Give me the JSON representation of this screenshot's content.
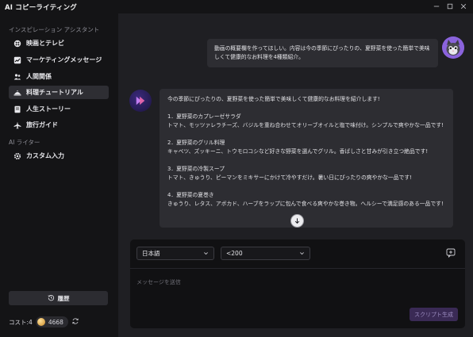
{
  "app": {
    "title": "AI コピーライティング"
  },
  "sidebar": {
    "section1_label": "インスピレーション アシスタント",
    "items": [
      {
        "label": "映画とテレビ",
        "icon": "film-icon"
      },
      {
        "label": "マーケティングメッセージ",
        "icon": "chart-icon"
      },
      {
        "label": "人間関係",
        "icon": "people-icon"
      },
      {
        "label": "料理チュートリアル",
        "icon": "cooking-icon",
        "active": true
      },
      {
        "label": "人生ストーリー",
        "icon": "book-icon"
      },
      {
        "label": "旅行ガイド",
        "icon": "plane-icon"
      }
    ],
    "section2_label": "AI ライター",
    "writer_items": [
      {
        "label": "カスタム入力",
        "icon": "gear-icon"
      }
    ],
    "history_label": "履歴",
    "cost_label": "コスト:4",
    "credits": "4668"
  },
  "chat": {
    "user_message": "動画の概要欄を作ってほしい。内容は今の季節にぴったりの、夏野菜を使った簡単で美味しくて健康的なお料理を4種類紹介。",
    "bot_message": "今の季節にぴったりの、夏野菜を使った簡単で美味しくて健康的なお料理を紹介します!\n\n1．夏野菜のカプレーゼサラダ\nトマト、モッツァレラチーズ、バジルを重ね合わせてオリーブオイルと塩で味付け。シンプルで爽やかな一品です!\n\n2．夏野菜のグリル料理\nキャベツ、ズッキーニ、トウモロコシなど好きな野菜を選んでグリル。香ばしさと甘みが引き立つ絶品です!\n\n3．夏野菜の冷製スープ\nトマト、きゅうり、ピーマンをミキサーにかけて冷やすだけ。暑い日にぴったりの爽やかな一品です!\n\n4．夏野菜の夏巻き\nきゅうり、レタス、アボカド、ハーブをラップに包んで食べる爽やかな巻き物。ヘルシーで満足感のある一品です!"
  },
  "composer": {
    "language": "日本語",
    "length": "<200",
    "placeholder": "メッセージを送信",
    "generate_label": "スクリプト生成"
  },
  "colors": {
    "accent": "#3a2a55",
    "background": "#141416",
    "panel": "#1f1f23",
    "bubble": "#2d2d32"
  }
}
